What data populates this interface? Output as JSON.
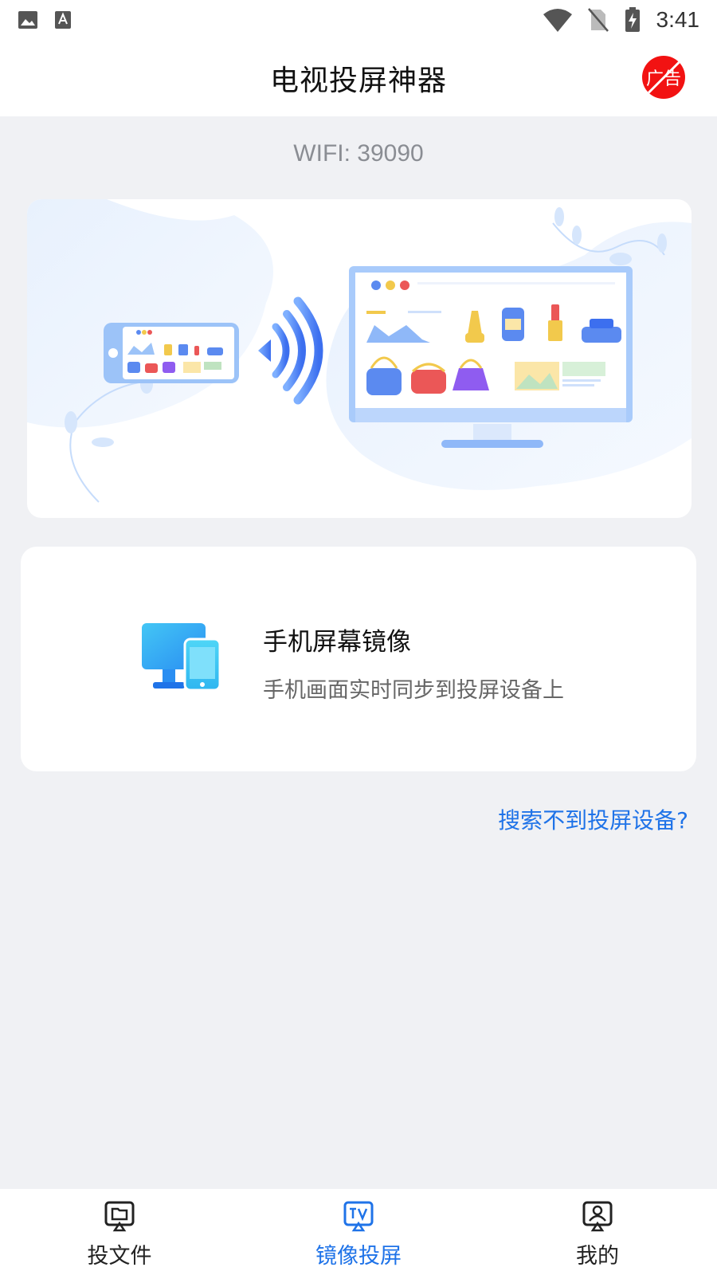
{
  "status_bar": {
    "time": "3:41",
    "icons": [
      "image-icon",
      "text-a-icon",
      "wifi-icon",
      "no-sim-icon",
      "battery-charging-icon"
    ]
  },
  "header": {
    "title": "电视投屏神器",
    "ad_badge": "广告"
  },
  "wifi": {
    "label": "WIFI: 39090"
  },
  "banner": {
    "illustration": "phone-to-tv-cast-illustration"
  },
  "mirror_card": {
    "title": "手机屏幕镜像",
    "description": "手机画面实时同步到投屏设备上",
    "icon": "screen-mirror-icon"
  },
  "help_link": "搜索不到投屏设备?",
  "bottom_nav": {
    "items": [
      {
        "label": "投文件",
        "icon": "cast-file-icon",
        "active": false
      },
      {
        "label": "镜像投屏",
        "icon": "tv-mirror-icon",
        "active": true
      },
      {
        "label": "我的",
        "icon": "profile-icon",
        "active": false
      }
    ]
  },
  "colors": {
    "accent": "#1f73e8",
    "ad_red": "#f21212",
    "background": "#f0f1f4"
  }
}
